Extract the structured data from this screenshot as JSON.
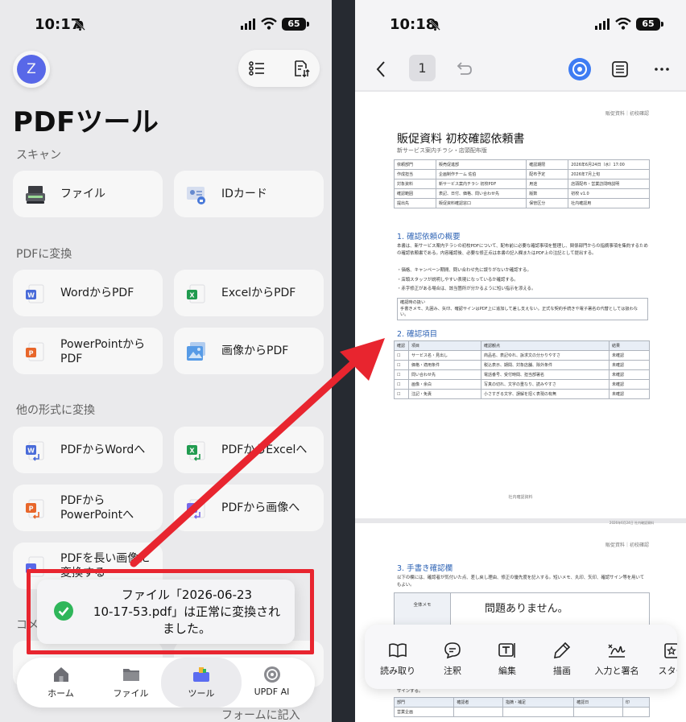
{
  "left": {
    "status": {
      "time": "10:17",
      "battery": "65"
    },
    "avatar_letter": "Z",
    "title": "PDFツール",
    "sections": {
      "scan": "スキャン",
      "to_pdf": "PDFに変換",
      "other_formats": "他の形式に変換",
      "comment": "コメ"
    },
    "tools": {
      "file": "ファイル",
      "id_card": "IDカード",
      "word_to_pdf": "WordからPDF",
      "excel_to_pdf": "ExcelからPDF",
      "ppt_to_pdf_1": "PowerPointから",
      "ppt_to_pdf_2": "PDF",
      "image_to_pdf": "画像からPDF",
      "pdf_to_word": "PDFからWordへ",
      "pdf_to_excel": "PDFからExcelへ",
      "pdf_to_ppt_1": "PDFから",
      "pdf_to_ppt_2": "PowerPointへ",
      "pdf_to_image": "PDFから画像へ",
      "pdf_to_long_1": "PDFを長い画像に",
      "pdf_to_long_2": "変換する",
      "form_fill": "フォームに記入"
    },
    "toast": {
      "line1": "ファイル「2026-06-23",
      "line2": "10-17-53.pdf」は正常に変換され",
      "line3": "ました。"
    },
    "tabbar": {
      "home": "ホーム",
      "file": "ファイル",
      "tool": "ツール",
      "ai": "UPDF AI"
    }
  },
  "right": {
    "status": {
      "time": "10:18",
      "battery": "65"
    },
    "page_number": "1",
    "doc": {
      "header": "販促資料｜初校確認",
      "title": "販促資料 初校確認依頼書",
      "subtitle": "新サービス案内チラシ・店頭配布版",
      "info": [
        [
          "依頼部門",
          "販売促進部",
          "確認期限",
          "2026年6月24日（水）17:00"
        ],
        [
          "作成担当",
          "企画制作チーム 佐伯",
          "配布予定",
          "2026年7月上旬"
        ],
        [
          "対象資料",
          "新サービス案内チラシ 初校PDF",
          "用途",
          "店頭配布・営業訪問時説明"
        ],
        [
          "確認範囲",
          "表記、日付、価格、問い合わせ先",
          "版数",
          "初校 v1.0"
        ],
        [
          "提出先",
          "販促資料確認窓口",
          "保管区分",
          "社内確認用"
        ]
      ],
      "sec1": "1. 確認依頼の概要",
      "sec1_text": "本書は、新サービス案内チラシの初校PDFについて、配布前に必要な確認事項を整理し、関係部門からの指摘事項を集約するための確認依頼書である。内容確認後、必要な修正点は本書の記入欄またはPDF上の注記として提出する。",
      "bullets": [
        "・価格、キャンペーン期間、問い合わせ先に誤りがないか確認する。",
        "・店頭スタッフが説明しやすい表現になっているか確認する。",
        "・赤字修正がある場合は、該当箇所が分かるように短い指示を添える。"
      ],
      "note_title": "確認時の扱い",
      "note_text": "手書きメモ、丸囲み、矢印、確認サインはPDF上に追加して差し支えない。正式な契約手続きや電子署名の代替としては扱わない。",
      "sec2": "2. 確認項目",
      "check_header": [
        "確認",
        "項目",
        "確認観点",
        "結果"
      ],
      "checks": [
        [
          "☐",
          "サービス名・見出し",
          "商品名、表記ゆれ、訴求文の分かりやすさ",
          "未確認"
        ],
        [
          "☐",
          "価格・適用条件",
          "税込表示、期間、対象店舗、除外条件",
          "未確認"
        ],
        [
          "☐",
          "問い合わせ先",
          "電話番号、受付時間、担当部署名",
          "未確認"
        ],
        [
          "☐",
          "画像・余白",
          "写真の切れ、文字の重なり、読みやすさ",
          "未確認"
        ],
        [
          "☐",
          "注記・免責",
          "小さすぎる文字、誤解を招く表現の有無",
          "未確認"
        ]
      ],
      "footer": "社内確認資料",
      "page2_mark": "2026年6月24日 社内確認資料",
      "sec3": "3. 手書き確認欄",
      "sec3_text": "以下の欄には、確認者が気付いた点、差し戻し理由、修正の優先度を記入する。短いメモ、丸印、矢印、確認サイン等を用いてもよい。",
      "memo_label": "全体メモ",
      "handwritten": "問題ありません。",
      "sign_text": "サインする。",
      "sign_header": [
        "部門",
        "確認者",
        "指摘・補足",
        "確認日",
        "印"
      ],
      "sign_first": "営業企画"
    },
    "annotation_bar": {
      "read": "読み取り",
      "comment": "注釈",
      "edit": "編集",
      "draw": "描画",
      "fill_sign": "入力と署名",
      "stamp": "スター"
    }
  }
}
